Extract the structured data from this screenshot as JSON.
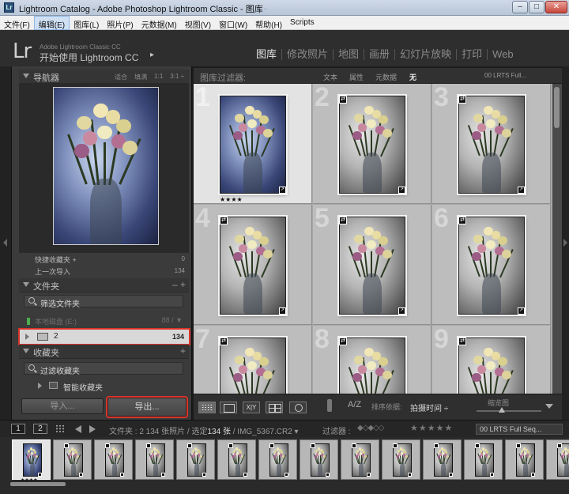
{
  "window": {
    "title": "Lightroom Catalog - Adobe Photoshop Lightroom Classic - 图库",
    "faint_title": "...",
    "min_glyph": "–",
    "max_glyph": "□",
    "close_glyph": "✕"
  },
  "menu": {
    "items": [
      "文件(F)",
      "编辑(E)",
      "图库(L)",
      "照片(P)",
      "元数据(M)",
      "视图(V)",
      "窗口(W)",
      "帮助(H)",
      "Scripts"
    ],
    "active_index": 1
  },
  "identity": {
    "logo": "Lr",
    "small_text": "Adobe Lightroom Classic CC",
    "main_text": "开始使用 Lightroom CC",
    "arrow": "▸"
  },
  "modules": {
    "items": [
      "图库",
      "修改照片",
      "地图",
      "画册",
      "幻灯片放映",
      "打印",
      "Web"
    ],
    "active_index": 0
  },
  "navigator": {
    "title": "导航器",
    "zoom_options": [
      "适合",
      "填满",
      "1:1",
      "3:1 ÷"
    ]
  },
  "catalog": {
    "rows": [
      {
        "label": "快捷收藏夹 +",
        "count": "0"
      },
      {
        "label": "上一次导入",
        "count": "134"
      }
    ]
  },
  "folders": {
    "title": "文件夹",
    "controls": "–  +",
    "filter_placeholder": "筛选文件夹",
    "volume_name": "本地磁盘 (E:)",
    "volume_size": "88 / ▼",
    "folder_name": "2",
    "folder_count": "134"
  },
  "collections": {
    "title": "收藏夹",
    "controls": "+",
    "filter_placeholder": "过滤收藏夹",
    "smart_label": "智能收藏夹"
  },
  "buttons": {
    "import": "导入...",
    "export": "导出..."
  },
  "filterbar": {
    "label": "图库过滤器:",
    "options": [
      "文本",
      "属性",
      "元数据",
      "无"
    ],
    "active_option": 3,
    "preset": "00 LRTS Full..."
  },
  "grid": {
    "cells": [
      {
        "num": "1",
        "selected": true,
        "stars": "★★★★"
      },
      {
        "num": "2",
        "selected": false,
        "stars": ""
      },
      {
        "num": "3",
        "selected": false,
        "stars": ""
      },
      {
        "num": "4",
        "selected": false,
        "stars": ""
      },
      {
        "num": "5",
        "selected": false,
        "stars": ""
      },
      {
        "num": "6",
        "selected": false,
        "stars": ""
      },
      {
        "num": "7",
        "selected": false,
        "stars": ""
      },
      {
        "num": "8",
        "selected": false,
        "stars": ""
      },
      {
        "num": "9",
        "selected": false,
        "stars": ""
      }
    ],
    "badge_glyph": "⇄",
    "badge2_glyph": "↗"
  },
  "toolbar": {
    "compare_label": "X|Y",
    "az_label": "A/Z",
    "sort_label": "排序依据:",
    "sort_value": "拍摄时间 ÷",
    "thumbs_label": "缩览图"
  },
  "filmstrip_bar": {
    "page1": "1",
    "page2": "2",
    "source_prefix": "文件夹 : 2",
    "source_mid": "  134 张照片 / 选定",
    "source_selected": "134 张",
    "source_file": " / IMG_5367.CR2 ▾",
    "filter_label": "过滤器 :",
    "diamonds": "◆◇◆◇◇",
    "stars": "★★★★★",
    "preset": "00 LRTS Full Seq..."
  },
  "filmstrip": {
    "count": 14,
    "selected_index": 0,
    "first_stars": "★★★★"
  },
  "colors": {
    "panel_bg": "#3b3b3b",
    "grid_bg": "#a7a7a7",
    "highlight_red": "#d9332a"
  }
}
